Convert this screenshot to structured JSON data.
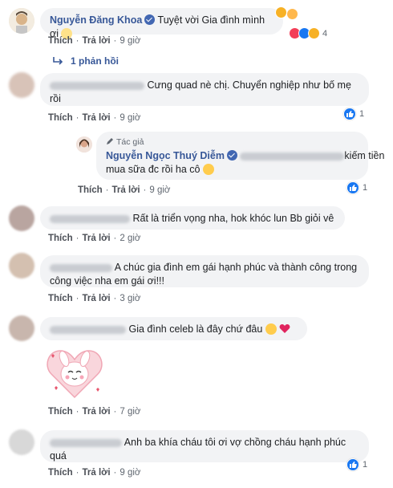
{
  "actions": {
    "like": "Thích",
    "reply": "Trả lời",
    "sep": "·"
  },
  "comments": [
    {
      "name": "Nguyễn Đăng Khoa",
      "text": "Tuyệt vời Gia đình mình ơi",
      "time": "9 giờ",
      "reaction_count": "4",
      "replies_link": "1 phản hồi"
    },
    {
      "text_line1": "Cưng quad nè chị. Chuyển nghiệp như bố mẹ",
      "text_line2": "rồi",
      "time": "9 giờ"
    },
    {
      "author_badge": "Tác giả",
      "name": "Nguyễn Ngọc Thuý Diễm",
      "text_line1": "kiếm tiền",
      "text_line2": "mua sữa đc rồi ha cô",
      "time": "9 giờ"
    },
    {
      "text": "Rất là triển vọng nha, hok khóc lun Bb giỏi vê",
      "time": "2 giờ"
    },
    {
      "text_line1": "A chúc gia đình em gái hạnh phúc và thành công trong",
      "text_line2": "công việc nha em gái ơi!!!",
      "time": "3 giờ"
    },
    {
      "text": "Gia đình celeb là đây chứ đâu",
      "time": ""
    },
    {
      "time": "7 giờ"
    },
    {
      "text_line1": "Anh ba khía cháu tôi ơi vợ chồng cháu hạnh phúc",
      "text_line2": "quá",
      "time": "9 giờ"
    }
  ],
  "colors": {
    "name": "#385898",
    "bubble": "#f2f3f5",
    "like": "#1877f2",
    "meta": "#606770"
  }
}
